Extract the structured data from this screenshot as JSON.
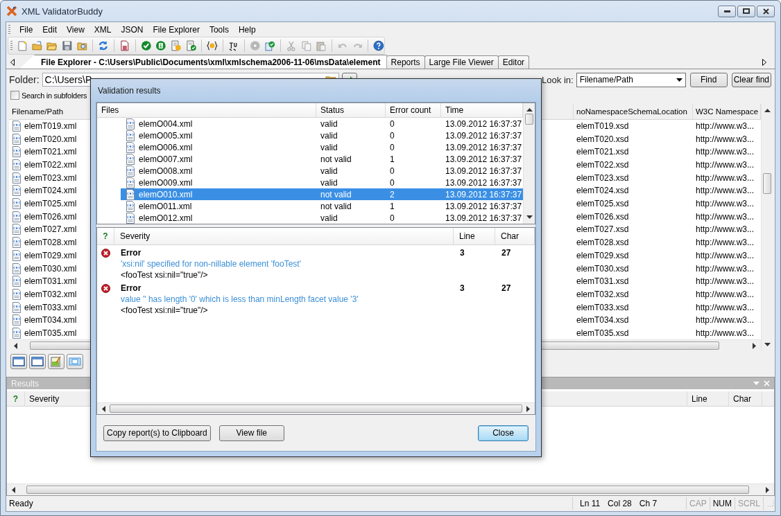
{
  "window": {
    "title": "XML ValidatorBuddy"
  },
  "menu": [
    "File",
    "Edit",
    "View",
    "XML",
    "JSON",
    "File Explorer",
    "Tools",
    "Help"
  ],
  "tabs": [
    {
      "label": "File Explorer - C:\\Users\\Public\\Documents\\xml\\xmlschema2006-11-06\\msData\\element",
      "selected": true
    },
    {
      "label": "Reports",
      "selected": false
    },
    {
      "label": "Large File Viewer",
      "selected": false
    },
    {
      "label": "Editor",
      "selected": false
    }
  ],
  "folder": {
    "label": "Folder:",
    "value": "C:\\Users\\P"
  },
  "search_subfolders": {
    "label": "Search in subfolders",
    "checked": false
  },
  "look_in": {
    "label": "Look in:",
    "value": "Filename/Path"
  },
  "find_buttons": [
    "Find",
    "Clear find"
  ],
  "file_list": {
    "columns": [
      "Filename/Path",
      "noNamespaceSchemaLocation",
      "W3C Namespace"
    ],
    "rows": [
      {
        "name": "elemT019.xml",
        "schema": "elemT019.xsd",
        "namespace": "http://www.w3..."
      },
      {
        "name": "elemT020.xml",
        "schema": "elemT020.xsd",
        "namespace": "http://www.w3..."
      },
      {
        "name": "elemT021.xml",
        "schema": "elemT021.xsd",
        "namespace": "http://www.w3..."
      },
      {
        "name": "elemT022.xml",
        "schema": "elemT022.xsd",
        "namespace": "http://www.w3..."
      },
      {
        "name": "elemT023.xml",
        "schema": "elemT023.xsd",
        "namespace": "http://www.w3..."
      },
      {
        "name": "elemT024.xml",
        "schema": "elemT024.xsd",
        "namespace": "http://www.w3..."
      },
      {
        "name": "elemT025.xml",
        "schema": "elemT025.xsd",
        "namespace": "http://www.w3..."
      },
      {
        "name": "elemT026.xml",
        "schema": "elemT026.xsd",
        "namespace": "http://www.w3..."
      },
      {
        "name": "elemT027.xml",
        "schema": "elemT027.xsd",
        "namespace": "http://www.w3..."
      },
      {
        "name": "elemT028.xml",
        "schema": "elemT028.xsd",
        "namespace": "http://www.w3..."
      },
      {
        "name": "elemT029.xml",
        "schema": "elemT029.xsd",
        "namespace": "http://www.w3..."
      },
      {
        "name": "elemT030.xml",
        "schema": "elemT030.xsd",
        "namespace": "http://www.w3..."
      },
      {
        "name": "elemT031.xml",
        "schema": "elemT031.xsd",
        "namespace": "http://www.w3..."
      },
      {
        "name": "elemT032.xml",
        "schema": "elemT032.xsd",
        "namespace": "http://www.w3..."
      },
      {
        "name": "elemT033.xml",
        "schema": "elemT033.xsd",
        "namespace": "http://www.w3..."
      },
      {
        "name": "elemT034.xml",
        "schema": "elemT034.xsd",
        "namespace": "http://www.w3..."
      },
      {
        "name": "elemT035.xml",
        "schema": "elemT035.xsd",
        "namespace": "http://www.w3..."
      }
    ]
  },
  "results": {
    "title": "Results",
    "columns": [
      "?",
      "Severity",
      "Line",
      "Char"
    ]
  },
  "status_bar": {
    "text": "Ready",
    "position": [
      "Ln 11",
      "Col 28",
      "Ch 7"
    ],
    "indicators": [
      {
        "label": "CAP",
        "on": false
      },
      {
        "label": "NUM",
        "on": true
      },
      {
        "label": "SCRL",
        "on": false
      }
    ]
  },
  "dialog": {
    "title": "Validation results",
    "files": {
      "columns": [
        "Files",
        "Status",
        "Error count",
        "Time"
      ],
      "rows": [
        {
          "file": "elemO004.xml",
          "status": "valid",
          "errors": "0",
          "time": "13.09.2012 16:37:37",
          "selected": false
        },
        {
          "file": "elemO005.xml",
          "status": "valid",
          "errors": "0",
          "time": "13.09.2012 16:37:37",
          "selected": false
        },
        {
          "file": "elemO006.xml",
          "status": "valid",
          "errors": "0",
          "time": "13.09.2012 16:37:37",
          "selected": false
        },
        {
          "file": "elemO007.xml",
          "status": "not valid",
          "errors": "1",
          "time": "13.09.2012 16:37:37",
          "selected": false
        },
        {
          "file": "elemO008.xml",
          "status": "valid",
          "errors": "0",
          "time": "13.09.2012 16:37:37",
          "selected": false
        },
        {
          "file": "elemO009.xml",
          "status": "valid",
          "errors": "0",
          "time": "13.09.2012 16:37:37",
          "selected": false
        },
        {
          "file": "elemO010.xml",
          "status": "not valid",
          "errors": "2",
          "time": "13.09.2012 16:37:37",
          "selected": true
        },
        {
          "file": "elemO011.xml",
          "status": "not valid",
          "errors": "1",
          "time": "13.09.2012 16:37:37",
          "selected": false
        },
        {
          "file": "elemO012.xml",
          "status": "valid",
          "errors": "0",
          "time": "13.09.2012 16:37:37",
          "selected": false
        }
      ]
    },
    "messages": {
      "columns": [
        "?",
        "Severity",
        "Line",
        "Char"
      ],
      "items": [
        {
          "severity": "Error",
          "line": "3",
          "char": "27",
          "message": "'xsi:nil' specified for non-nillable element 'fooTest'",
          "code": "<fooTest xsi:nil=\"true\"/>"
        },
        {
          "severity": "Error",
          "line": "3",
          "char": "27",
          "message": "value '' has length '0' which is less than minLength facet value '3'",
          "code": "<fooTest xsi:nil=\"true\"/>"
        }
      ]
    },
    "buttons": [
      {
        "label": "Copy report(s) to Clipboard",
        "default": false
      },
      {
        "label": "View file",
        "default": false
      },
      {
        "label": "Close",
        "default": true
      }
    ]
  }
}
